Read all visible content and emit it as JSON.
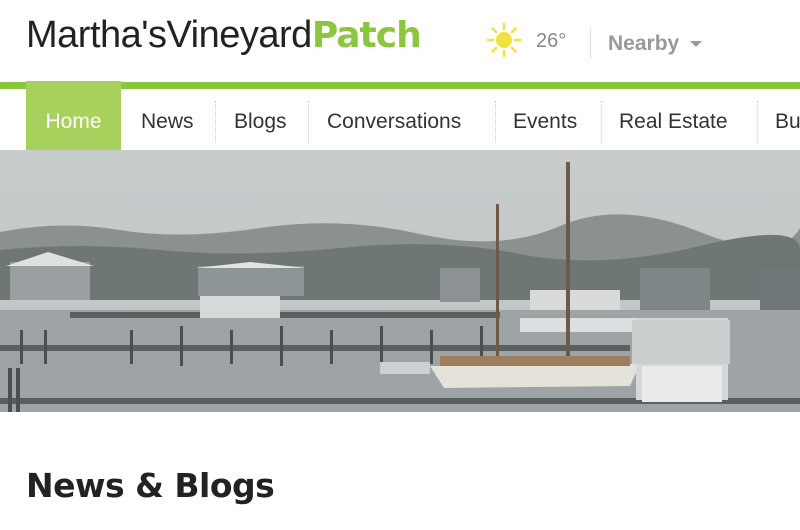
{
  "header": {
    "site_name": "Martha'sVineyard",
    "brand": "Patch",
    "temperature": "26°",
    "nearby_label": "Nearby",
    "weather_icon": "sun-icon"
  },
  "nav": {
    "items": [
      {
        "label": "Home",
        "active": true
      },
      {
        "label": "News"
      },
      {
        "label": "Blogs"
      },
      {
        "label": "Conversations"
      },
      {
        "label": "Events"
      },
      {
        "label": "Real Estate"
      },
      {
        "label": "Bu"
      }
    ]
  },
  "main": {
    "section_title": "News & Blogs"
  },
  "colors": {
    "brand_green": "#8cc63f",
    "active_tab": "#a8d05c"
  }
}
